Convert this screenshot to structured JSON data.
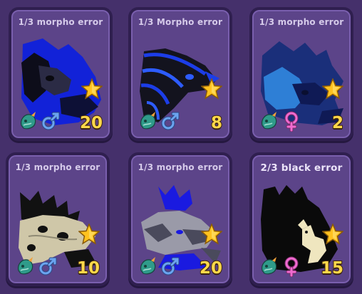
{
  "cards": [
    {
      "title": "1/3 morpho error",
      "count": "20",
      "gender": "male",
      "icons": [
        "pet-egg-icon",
        "male-icon",
        "star-icon"
      ],
      "palette": {
        "body": "#1222d8",
        "shade": "#0d0d1a",
        "accent": "#2b2b45"
      }
    },
    {
      "title": "1/3 Morpho error",
      "count": "8",
      "gender": "male",
      "icons": [
        "pet-egg-icon",
        "male-icon",
        "star-icon"
      ],
      "palette": {
        "body": "#13131e",
        "shade": "#1c3de8",
        "accent": "#2d5cff"
      }
    },
    {
      "title": "1/3 morpho error",
      "count": "2",
      "gender": "female",
      "icons": [
        "pet-egg-icon",
        "female-icon",
        "star-icon"
      ],
      "palette": {
        "body": "#1a2f7a",
        "shade": "#2e7fd6",
        "accent": "#0f1a55"
      }
    },
    {
      "title": "1/3 morpho error",
      "count": "10",
      "gender": "male",
      "icons": [
        "pet-egg-icon",
        "male-icon",
        "star-icon"
      ],
      "palette": {
        "body": "#cfc7a8",
        "shade": "#111111",
        "accent": "#8f8a74"
      }
    },
    {
      "title": "1/3 morpho error",
      "count": "20",
      "gender": "male",
      "icons": [
        "pet-egg-icon",
        "male-icon",
        "star-icon"
      ],
      "palette": {
        "body": "#9a9aa8",
        "shade": "#1a1ae0",
        "accent": "#4a4a5c"
      }
    },
    {
      "title": "2/3 black error",
      "count": "15",
      "gender": "female",
      "icons": [
        "pet-egg-icon",
        "female-icon",
        "star-icon"
      ],
      "palette": {
        "body": "#0a0a0a",
        "shade": "#efe6bf",
        "accent": "#1a1a1a"
      }
    }
  ],
  "colors": {
    "background": "#45306b",
    "card": "#5c4489",
    "count": "#ffd84a",
    "star": "#ffc21f",
    "male": "#6ba4f0",
    "female": "#f06bd0"
  }
}
